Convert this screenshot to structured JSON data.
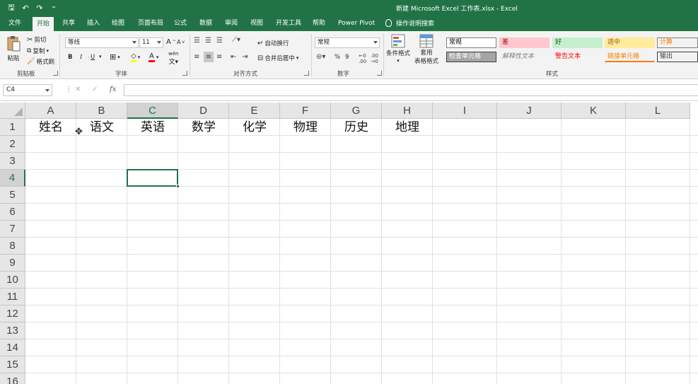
{
  "titlebar": {
    "title": "新建 Microsoft Excel 工作表.xlsx  -  Excel",
    "qat": [
      {
        "icon": "save-icon",
        "glyph": "🖫"
      },
      {
        "icon": "undo-icon",
        "glyph": "↶"
      },
      {
        "icon": "redo-icon",
        "glyph": "↷"
      },
      {
        "icon": "customize-qat-icon",
        "glyph": "⁼"
      }
    ]
  },
  "tabs": [
    "文件",
    "开始",
    "共享",
    "插入",
    "绘图",
    "页面布局",
    "公式",
    "数据",
    "审阅",
    "视图",
    "开发工具",
    "帮助",
    "Power Pivot"
  ],
  "active_tab": "开始",
  "tell_me": "操作说明搜索",
  "ribbon": {
    "clipboard": {
      "paste": "粘贴",
      "cut": "剪切",
      "copy": "复制",
      "format_painter": "格式刷",
      "label": "剪贴板"
    },
    "font": {
      "name": "等线",
      "size": "11",
      "bold": "B",
      "italic": "I",
      "underline": "U",
      "grow": "A",
      "shrink": "A",
      "label": "字体",
      "wen": "wén"
    },
    "alignment": {
      "wrap": "自动换行",
      "merge": "合并后居中",
      "label": "对齐方式"
    },
    "number": {
      "format": "常规",
      "percent": "%",
      "comma": "9",
      "label": "数字"
    },
    "styles": {
      "cond_format": "条件格式",
      "table_format_1": "套用",
      "table_format_2": "表格格式",
      "label": "样式",
      "cells": [
        {
          "text": "常规",
          "bg": "#ffffff",
          "color": "#000000",
          "border": "#808080"
        },
        {
          "text": "差",
          "bg": "#ffc7ce",
          "color": "#9c0006",
          "border": "#ffc7ce"
        },
        {
          "text": "好",
          "bg": "#c6efce",
          "color": "#006100",
          "border": "#c6efce"
        },
        {
          "text": "适中",
          "bg": "#ffeb9c",
          "color": "#9c5700",
          "border": "#ffeb9c"
        },
        {
          "text": "计算",
          "bg": "#f2f2f2",
          "color": "#fa7d00",
          "border": "#7f7f7f"
        },
        {
          "text": "检查单元格",
          "bg": "#a5a5a5",
          "color": "#ffffff",
          "border": "#3f3f3f"
        },
        {
          "text": "解释性文本",
          "bg": "#f3f3f3",
          "color": "#7f7f7f",
          "border": "#f3f3f3"
        },
        {
          "text": "警告文本",
          "bg": "#f3f3f3",
          "color": "#ff0000",
          "border": "#f3f3f3"
        },
        {
          "text": "链接单元格",
          "bg": "#f3f3f3",
          "color": "#fa7d00",
          "border": "#f3f3f3"
        },
        {
          "text": "输出",
          "bg": "#f2f2f2",
          "color": "#3f3f3f",
          "border": "#3f3f3f"
        }
      ]
    }
  },
  "formula_bar": {
    "name_box": "C4",
    "cancel": "✕",
    "enter": "✓",
    "fx": "fx",
    "formula": ""
  },
  "columns": [
    "A",
    "B",
    "C",
    "D",
    "E",
    "F",
    "G",
    "H",
    "I",
    "J",
    "K",
    "L"
  ],
  "selected_column": "C",
  "rows": [
    "1",
    "2",
    "3",
    "4",
    "5",
    "6",
    "7",
    "8",
    "9",
    "10",
    "11",
    "12",
    "13",
    "14",
    "15",
    "16"
  ],
  "selected_row": "4",
  "row1_values": [
    "姓名",
    "语文",
    "英语",
    "数学",
    "化学",
    "物理",
    "历史",
    "地理"
  ],
  "colors": {
    "accent": "#217346",
    "ribbon_bg": "#f3f3f3",
    "header_bg": "#e6e6e6"
  }
}
